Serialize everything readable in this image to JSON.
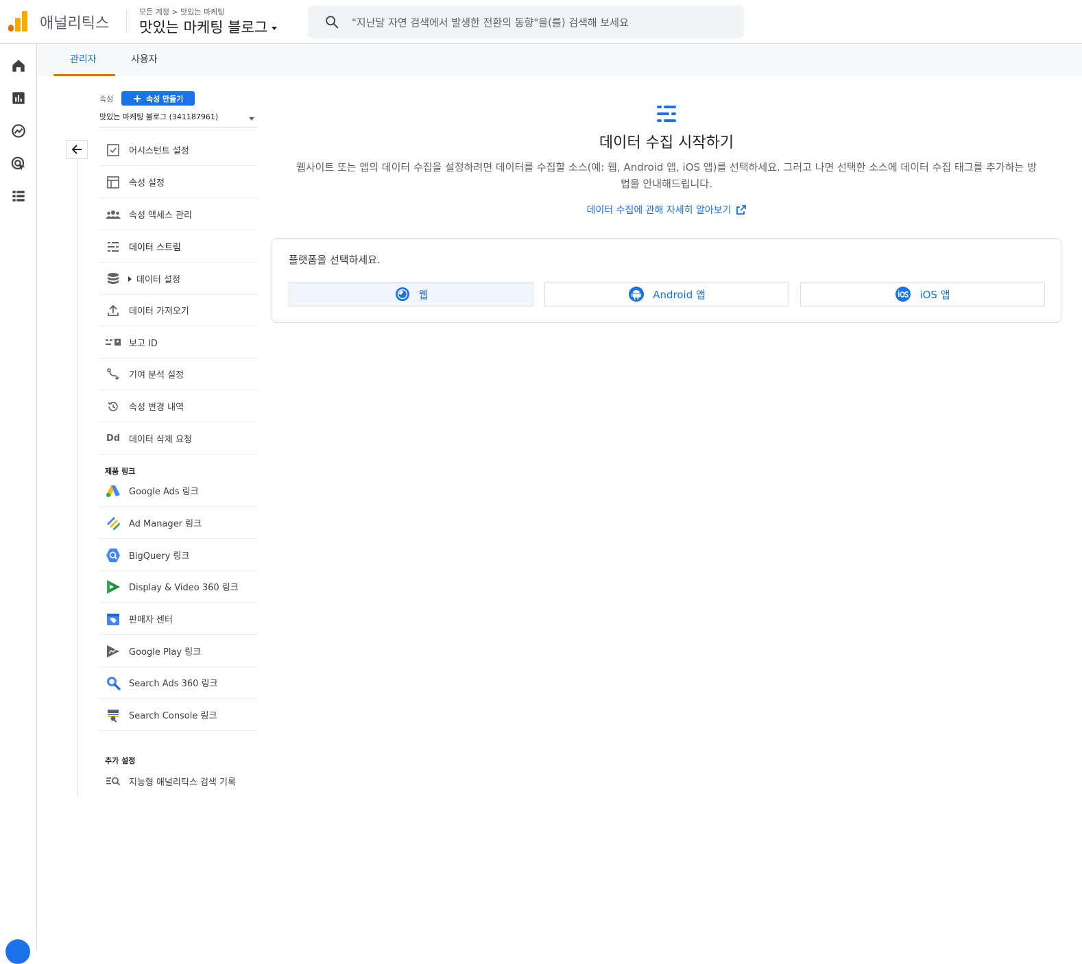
{
  "header": {
    "brand": "애널리틱스",
    "breadcrumb": "모든 계정 > 맛있는 마케팅",
    "property_title": "맛있는 마케팅 블로그",
    "search_placeholder": "\"지난달 자연 검색에서 발생한 전환의 동향\"을(를) 검색해 보세요",
    "brand_color": "#f9ab00"
  },
  "rail": {
    "items": [
      "home-icon",
      "reports-icon",
      "explore-icon",
      "advertising-icon",
      "configure-icon"
    ]
  },
  "tabs": [
    {
      "label": "관리자",
      "active": true
    },
    {
      "label": "사용자",
      "active": false
    }
  ],
  "property": {
    "label": "속성",
    "create_button": "속성 만들기",
    "selected": "맛있는 마케팅 블로그 (341187961)"
  },
  "menu": [
    {
      "label": "어시스턴트 설정",
      "icon": "checklist-icon"
    },
    {
      "label": "속성 설정",
      "icon": "property-settings-icon"
    },
    {
      "label": "속성 액세스 관리",
      "icon": "people-icon"
    },
    {
      "label": "데이터 스트림",
      "icon": "data-stream-icon",
      "active": true
    },
    {
      "label": "데이터 설정",
      "icon": "database-icon"
    },
    {
      "label": "데이터 가져오기",
      "icon": "upload-icon"
    },
    {
      "label": "보고 ID",
      "icon": "reporting-id-icon"
    },
    {
      "label": "기여 분석 설정",
      "icon": "attribution-icon"
    },
    {
      "label": "속성 변경 내역",
      "icon": "history-icon"
    },
    {
      "label": "데이터 삭제 요청",
      "icon": "data-deletion-icon"
    }
  ],
  "product_links": {
    "heading": "제품 링크",
    "items": [
      {
        "label": "Google Ads 링크",
        "icon": "google-ads-icon"
      },
      {
        "label": "Ad Manager 링크",
        "icon": "ad-manager-icon"
      },
      {
        "label": "BigQuery 링크",
        "icon": "bigquery-icon"
      },
      {
        "label": "Display & Video 360 링크",
        "icon": "dv360-icon"
      },
      {
        "label": "판매자 센터",
        "icon": "merchant-center-icon"
      },
      {
        "label": "Google Play 링크",
        "icon": "google-play-icon"
      },
      {
        "label": "Search Ads 360 링크",
        "icon": "search-ads-icon"
      },
      {
        "label": "Search Console 링크",
        "icon": "search-console-icon"
      }
    ]
  },
  "additional": {
    "heading": "추가 설정",
    "items": [
      {
        "label": "지능형 애널리틱스 검색 기록",
        "icon": "search-history-icon"
      }
    ]
  },
  "main": {
    "title": "데이터 수집 시작하기",
    "description": "웹사이트 또는 앱의 데이터 수집을 설정하려면 데이터를 수집할 소스(예: 웹, Android 앱, iOS 앱)를 선택하세요. 그러고 나면 선택한 소스에 데이터 수집 태그를 추가하는 방법을 안내해드립니다.",
    "learn_more": "데이터 수집에 관해 자세히 알아보기",
    "platform_title": "플랫폼을 선택하세요.",
    "platforms": [
      {
        "label": "웹",
        "icon": "web-icon"
      },
      {
        "label": "Android 앱",
        "icon": "android-icon"
      },
      {
        "label": "iOS 앱",
        "icon": "ios-icon"
      }
    ],
    "accent_color": "#1a73e8"
  }
}
